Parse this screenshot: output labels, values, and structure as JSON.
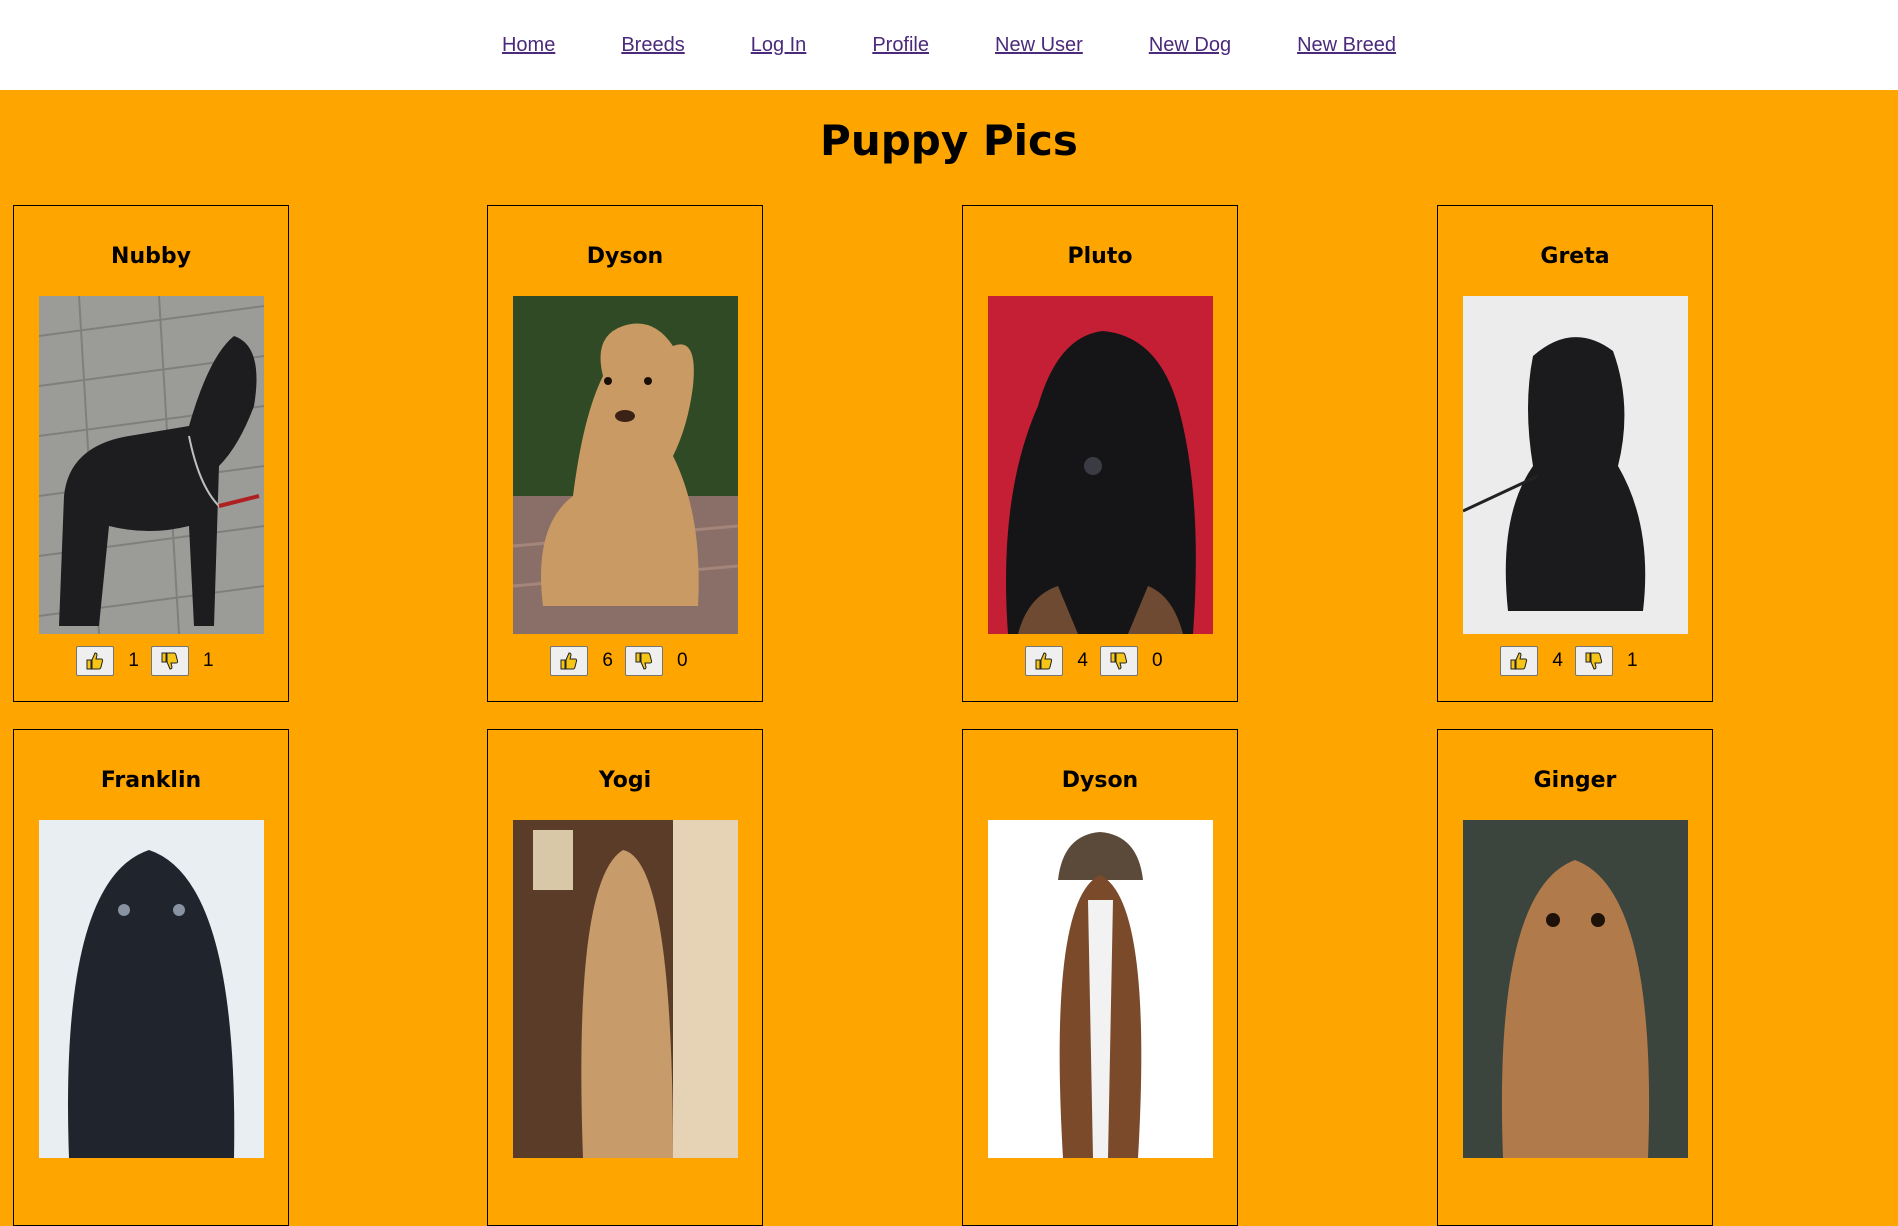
{
  "nav": {
    "items": [
      "Home",
      "Breeds",
      "Log In",
      "Profile",
      "New User",
      "New Dog",
      "New Breed"
    ]
  },
  "page": {
    "title": "Puppy Pics"
  },
  "colors": {
    "background": "#ffa500",
    "nav_link": "#4b2a7b"
  },
  "dogs": [
    {
      "name": "Nubby",
      "likes": "1",
      "dislikes": "1"
    },
    {
      "name": "Dyson",
      "likes": "6",
      "dislikes": "0"
    },
    {
      "name": "Pluto",
      "likes": "4",
      "dislikes": "0"
    },
    {
      "name": "Greta",
      "likes": "4",
      "dislikes": "1"
    },
    {
      "name": "Franklin"
    },
    {
      "name": "Yogi"
    },
    {
      "name": "Dyson"
    },
    {
      "name": "Ginger"
    }
  ],
  "icons": {
    "like": "thumbs-up-icon",
    "dislike": "thumbs-down-icon"
  }
}
